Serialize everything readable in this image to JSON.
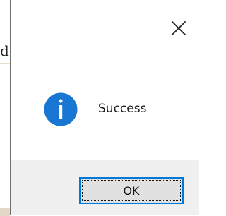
{
  "background": {
    "partial_text": "d"
  },
  "dialog": {
    "close_icon": "close-icon",
    "icon": "info-icon",
    "message": "Success",
    "ok_label": "OK"
  },
  "colors": {
    "accent": "#0078d7",
    "icon_blue": "#1976d2",
    "footer_bg": "#f0f0f0",
    "button_bg": "#e1e1e1"
  }
}
